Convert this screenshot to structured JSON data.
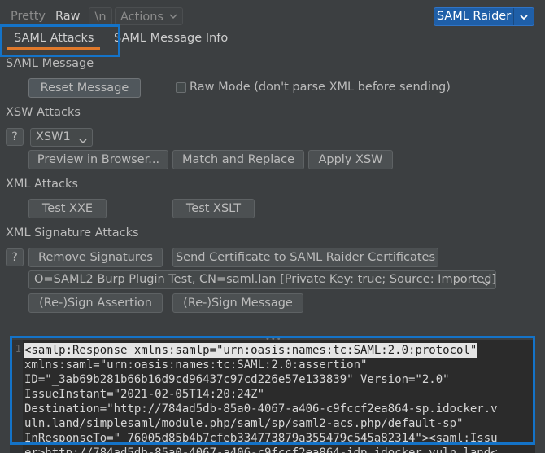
{
  "toolbar": {
    "pretty": "Pretty",
    "raw": "Raw",
    "newline": "\\n",
    "actions": "Actions",
    "saml_raider": "SAML Raider"
  },
  "tabs": [
    {
      "label": "SAML Attacks",
      "active": true
    },
    {
      "label": "SAML Message Info",
      "active": false
    }
  ],
  "saml_message": {
    "title": "SAML Message",
    "reset_label": "Reset Message",
    "raw_mode_label": "Raw Mode (don't parse XML before sending)",
    "raw_mode_checked": false
  },
  "xsw": {
    "title": "XSW Attacks",
    "help": "?",
    "selected": "XSW1",
    "preview_label": "Preview in Browser...",
    "match_replace_label": "Match and Replace",
    "apply_label": "Apply XSW"
  },
  "xml_attacks": {
    "title": "XML Attacks",
    "xxe_label": "Test XXE",
    "xslt_label": "Test XSLT"
  },
  "signature": {
    "title": "XML Signature Attacks",
    "help": "?",
    "remove_label": "Remove Signatures",
    "send_cert_label": "Send Certificate to SAML Raider Certificates",
    "certificate": "O=SAML2 Burp Plugin Test, CN=saml.lan [Private Key: true; Source: Imported]",
    "sign_assertion_label": "(Re-)Sign Assertion",
    "sign_message_label": "(Re-)Sign Message"
  },
  "editor": {
    "line_number": "1",
    "first_line": "<samlp:Response xmlns:samlp=\"urn:oasis:names:tc:SAML:2.0:protocol\"",
    "rest": "xmlns:saml=\"urn:oasis:names:tc:SAML:2.0:assertion\"\nID=\"_3ab69b281b66b16d9cd96437c97cd226e57e133839\" Version=\"2.0\"\nIssueInstant=\"2021-02-05T14:20:24Z\"\nDestination=\"http://784ad5db-85a0-4067-a406-c9fccf2ea864-sp.idocker.v\nuln.land/simplesaml/module.php/saml/sp/saml2-acs.php/default-sp\"\nInResponseTo=\"_76005d85b4b7cfeb334773879a355479c545a82314\"><saml:Issu\ner>http://784ad5db-85a0-4067-a406-c9fccf2ea864-idp.idocker.vuln.land<"
  },
  "colors": {
    "background": "#3c3f41",
    "accent_blue": "#1473c8",
    "tab_underline": "#e0792b",
    "saml_raider_button": "#1f5fa8"
  }
}
